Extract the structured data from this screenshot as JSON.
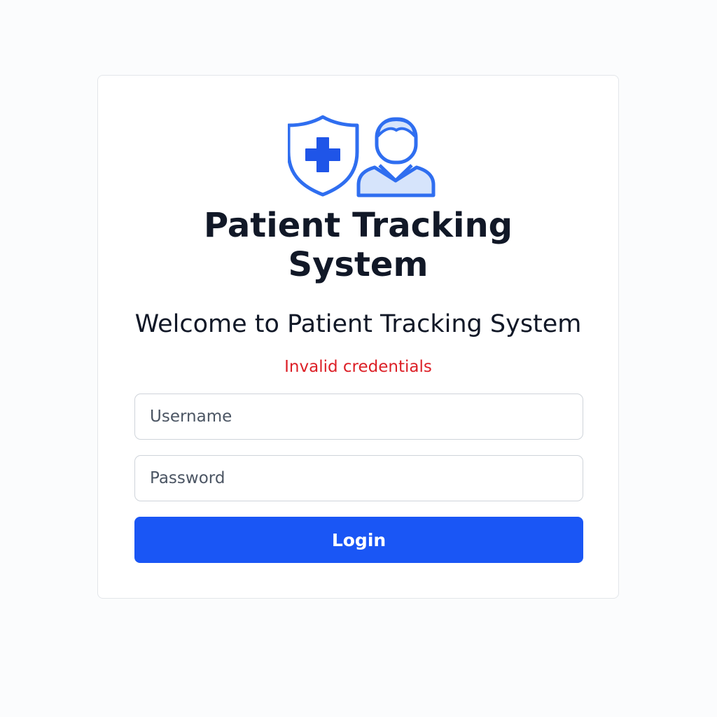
{
  "brand": {
    "title_lines": [
      "Patient Tracking",
      "System"
    ],
    "logo_icons": [
      "medical-shield-icon",
      "doctor-avatar-icon"
    ],
    "accent_color": "#1a56f5"
  },
  "login": {
    "welcome": "Welcome to Patient Tracking System",
    "error_message": "Invalid credentials",
    "error_color": "#dc1f26",
    "username_placeholder": "Username",
    "username_value": "",
    "password_placeholder": "Password",
    "password_value": "",
    "submit_label": "Login"
  }
}
